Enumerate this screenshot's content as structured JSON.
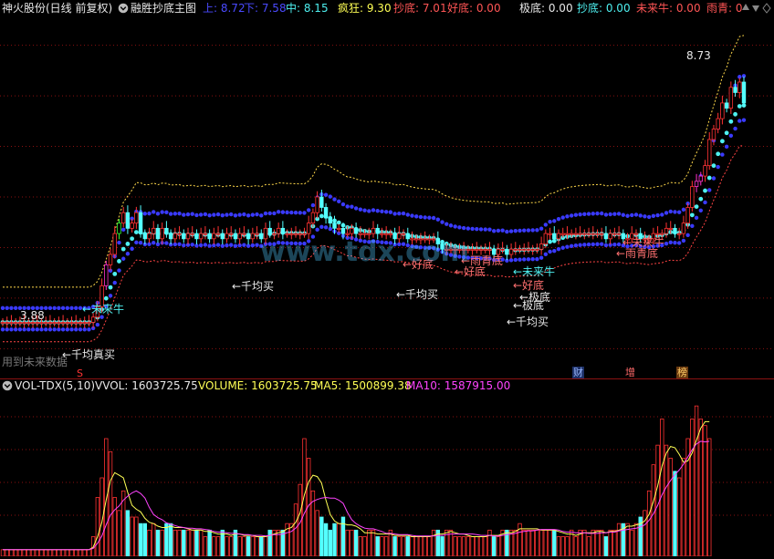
{
  "header": {
    "stock": "神火股份(日线 前复权)",
    "indicator": "融胜抄底主图",
    "up": "上: 8.72",
    "down": "下: 7.58",
    "mid": "中: 8.15",
    "crazy": "疯狂: 9.30",
    "bottom": "抄底: 7.01",
    "good_bottom": "好底: 0.00",
    "extreme_bottom": "极底: 0.00",
    "bottom2": "抄底: 0.00",
    "future_bull": "未来牛: 0.00",
    "rain_green": "雨青: 0"
  },
  "labels": {
    "high_price": "8.73",
    "low_price": "3.88",
    "future_data": "用到未来数据",
    "watermark": "www.tdx.com",
    "qianjun_buy": "←千均买",
    "future_bull_arrow": "←未来牛",
    "good_bottom_arrow": "←好底",
    "extreme_bottom_arrow": "←极底",
    "yuqing_arrow": "←雨青底",
    "qianjun_zhen": "←千均真买",
    "s_marker": "S"
  },
  "tags": {
    "cai": "财",
    "zeng": "增",
    "bang": "榜"
  },
  "volume_header": {
    "name": "VOL-TDX(5,10)",
    "vvol": "VVOL: 1603725.75",
    "volume": "VOLUME: 1603725.75",
    "ma5": "MA5: 1500899.38",
    "ma10": "MA10: 1587915.00"
  },
  "colors": {
    "up_candle": "#ff3232",
    "down_candle": "#54ffff",
    "blue_band": "#3a3aff",
    "cyan_mid": "#4ef0f0",
    "ma5": "#ffff55",
    "ma10": "#ff44ff",
    "grid": "#8a1111"
  },
  "chart_data": {
    "type": "candlestick",
    "close": [
      3.9,
      3.9,
      3.9,
      3.9,
      3.9,
      3.9,
      3.9,
      3.9,
      3.9,
      3.9,
      3.9,
      3.9,
      3.9,
      3.9,
      3.9,
      3.9,
      3.9,
      3.9,
      3.9,
      3.9,
      3.9,
      4.0,
      4.2,
      4.6,
      5.0,
      5.2,
      5.6,
      5.8,
      6.0,
      5.7,
      5.8,
      6.0,
      5.6,
      5.5,
      5.6,
      5.7,
      5.5,
      5.7,
      5.6,
      5.5,
      5.6,
      5.6,
      5.5,
      5.6,
      5.6,
      5.5,
      5.6,
      5.6,
      5.5,
      5.6,
      5.6,
      5.5,
      5.6,
      5.6,
      5.5,
      5.6,
      5.6,
      5.5,
      5.6,
      5.6,
      5.5,
      5.7,
      5.6,
      5.6,
      5.7,
      5.6,
      5.6,
      5.6,
      5.6,
      5.6,
      5.6,
      5.8,
      6.0,
      6.3,
      6.1,
      5.9,
      5.8,
      5.7,
      5.7,
      5.6,
      5.6,
      5.7,
      5.6,
      5.6,
      5.6,
      5.6,
      5.7,
      5.6,
      5.6,
      5.6,
      5.6,
      5.5,
      5.6,
      5.6,
      5.5,
      5.5,
      5.5,
      5.5,
      5.5,
      5.5,
      5.5,
      5.4,
      5.3,
      5.3,
      5.3,
      5.3,
      5.3,
      5.3,
      5.3,
      5.3,
      5.3,
      5.3,
      5.3,
      5.3,
      5.2,
      5.3,
      5.3,
      5.2,
      5.3,
      5.3,
      5.3,
      5.3,
      5.3,
      5.3,
      5.3,
      5.4,
      5.6,
      5.6,
      5.5,
      5.6,
      5.6,
      5.6,
      5.6,
      5.6,
      5.6,
      5.6,
      5.6,
      5.6,
      5.6,
      5.6,
      5.5,
      5.6,
      5.6,
      5.6,
      5.5,
      5.5,
      5.6,
      5.6,
      5.5,
      5.5,
      5.5,
      5.6,
      5.6,
      5.6,
      5.7,
      5.7,
      5.6,
      5.6,
      5.8,
      6.1,
      6.5,
      6.6,
      6.7,
      6.9,
      7.4,
      7.6,
      7.8,
      8.1,
      8.0,
      8.4,
      8.3,
      8.5,
      8.1
    ],
    "volume": [
      1,
      1,
      1,
      1,
      1,
      1,
      1,
      1,
      1,
      1,
      1,
      1,
      1,
      1,
      1,
      1,
      1,
      1,
      1,
      1,
      1,
      3,
      9,
      12,
      18,
      16,
      9,
      7,
      10,
      7,
      6,
      6,
      5,
      5,
      4,
      5,
      4,
      4,
      5,
      5,
      4,
      4,
      4,
      4,
      4,
      4,
      4,
      3,
      4,
      3,
      3,
      4,
      3,
      3,
      4,
      3,
      3,
      3,
      3,
      3,
      3,
      3,
      4,
      4,
      4,
      4,
      5,
      5,
      8,
      11,
      18,
      15,
      10,
      7,
      6,
      5,
      4,
      5,
      5,
      6,
      4,
      4,
      4,
      3,
      3,
      4,
      4,
      3,
      3,
      3,
      4,
      3,
      3,
      3,
      3,
      3,
      3,
      3,
      3,
      3,
      4,
      4,
      3,
      4,
      4,
      3,
      3,
      3,
      3,
      3,
      3,
      3,
      3,
      4,
      3,
      3,
      4,
      4,
      4,
      4,
      5,
      4,
      4,
      4,
      4,
      4,
      4,
      4,
      4,
      3,
      3,
      3,
      4,
      3,
      4,
      4,
      3,
      4,
      4,
      4,
      3,
      4,
      4,
      5,
      5,
      5,
      4,
      5,
      6,
      7,
      10,
      14,
      17,
      21,
      17,
      15,
      13,
      12,
      15,
      18,
      21,
      23,
      21,
      20,
      18
    ]
  }
}
